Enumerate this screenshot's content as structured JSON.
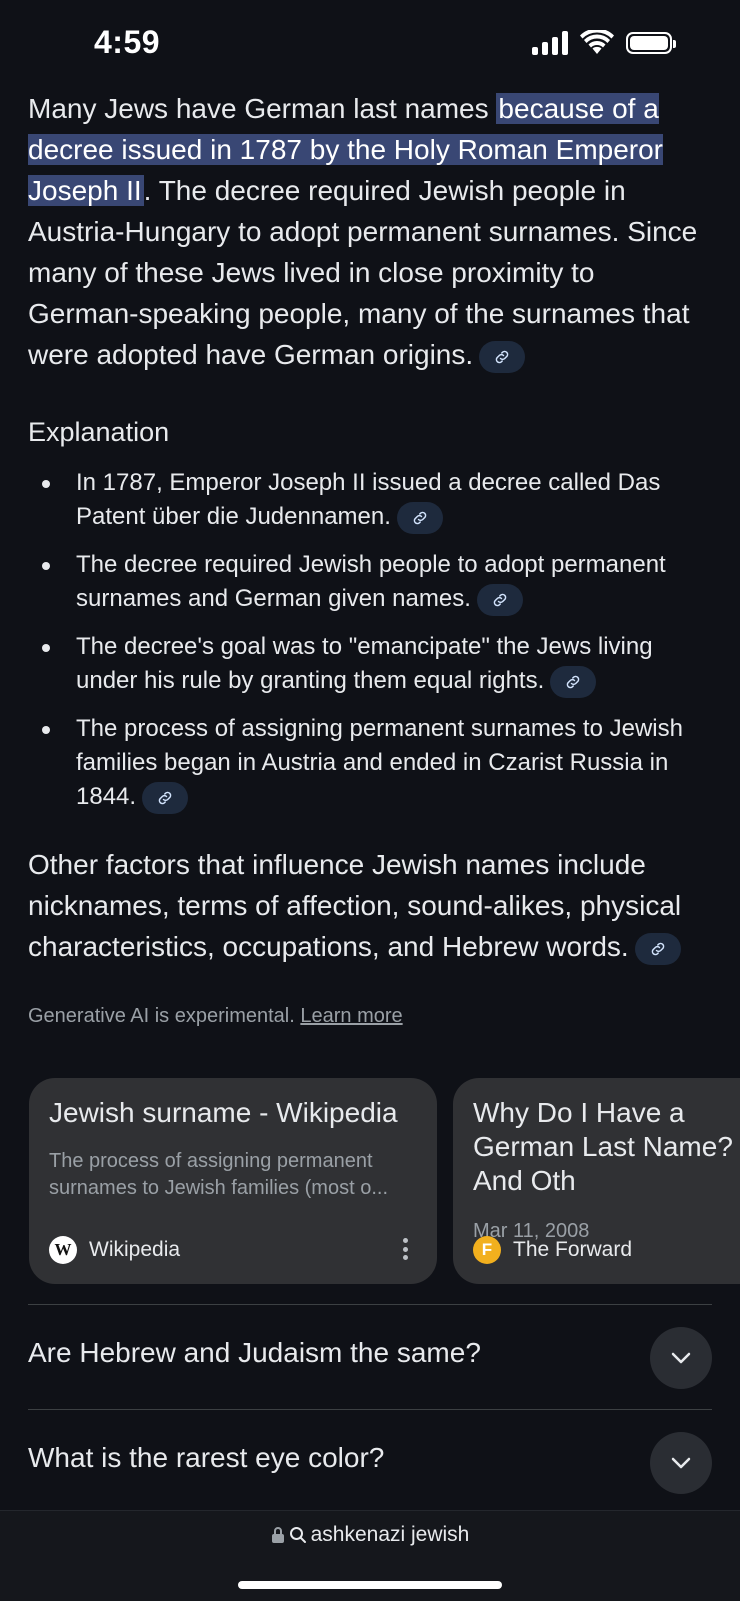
{
  "status": {
    "time": "4:59"
  },
  "answer": {
    "intro_before": "Many Jews have German last names ",
    "intro_highlight": "because of a decree issued in 1787 by the Holy Roman Emperor Joseph II",
    "intro_after": ". The decree required Jewish people in Austria-Hungary to adopt permanent surnames. Since many of these Jews lived in close proximity to German-speaking people, many of the surnames that were adopted have German origins.",
    "explanation_heading": "Explanation",
    "points": [
      "In 1787, Emperor Joseph II issued a decree called Das Patent über die Judennamen.",
      "The decree required Jewish people to adopt permanent surnames and German given names.",
      "The decree's goal was to \"emancipate\" the Jews living under his rule by granting them equal rights.",
      "The process of assigning permanent surnames to Jewish families began in Austria and ended in Czarist Russia in 1844."
    ],
    "other_factors": "Other factors that influence Jewish names include nicknames, terms of affection, sound-alikes, physical characteristics, occupations, and Hebrew words.",
    "disclaimer": "Generative AI is experimental.",
    "learn_more": "Learn more"
  },
  "sources": [
    {
      "title": "Jewish surname - Wikipedia",
      "snippet": "The process of assigning permanent surnames to Jewish families (most o...",
      "source": "Wikipedia",
      "icon": "wikipedia-icon"
    },
    {
      "title": "Why Do I Have a German Last Name? And Oth",
      "date": "Mar 11, 2008",
      "source": "The Forward",
      "icon": "forward-icon",
      "icon_color": "#f2b01e"
    }
  ],
  "related_questions": [
    "Are Hebrew and Judaism the same?",
    "What is the rarest eye color?"
  ],
  "address_bar": {
    "query": "ashkenazi jewish"
  },
  "colors": {
    "background": "#0f1117",
    "highlight": "#394774",
    "chip": "#1e2a3d",
    "card": "#303134"
  }
}
